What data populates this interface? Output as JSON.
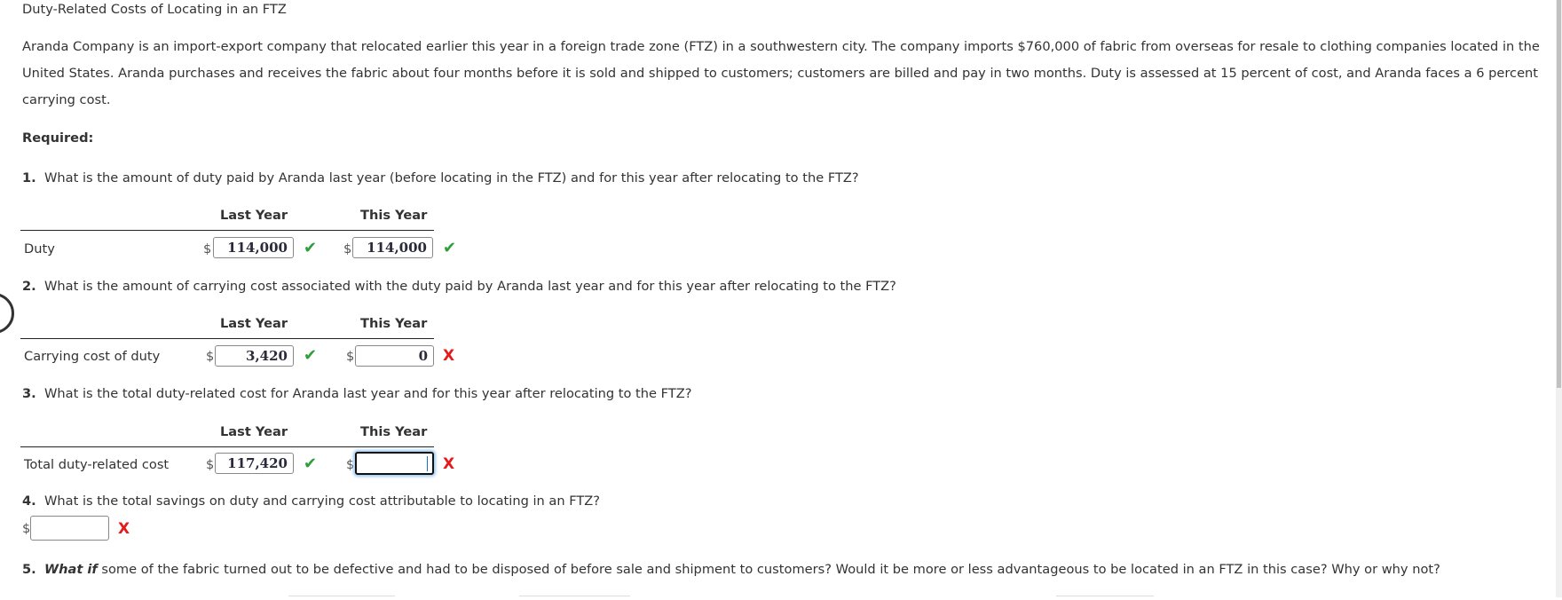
{
  "title": "Duty-Related Costs of Locating in an FTZ",
  "intro": "Aranda Company is an import-export company that relocated earlier this year in a foreign trade zone (FTZ) in a southwestern city. The company imports $760,000 of fabric from overseas for resale to clothing companies located in the United States. Aranda purchases and receives the fabric about four months before it is sold and shipped to customers; customers are billed and pay in two months. Duty is assessed at 15 percent of cost, and Aranda faces a 6 percent carrying cost.",
  "required_label": "Required:",
  "currency_symbol": "$",
  "columns": {
    "last_year": "Last Year",
    "this_year": "This Year"
  },
  "status_icons": {
    "correct": "✔",
    "incorrect": "X"
  },
  "colors": {
    "correct": "#2e9e3a",
    "incorrect": "#e31b1b",
    "focus_glow": "#9cc8f0"
  },
  "questions": [
    {
      "number": "1.",
      "text": "What is the amount of duty paid by Aranda last year (before locating in the FTZ) and for this year after relocating to the FTZ?",
      "row_label": "Duty",
      "last_year": {
        "value": "114,000",
        "status": "correct"
      },
      "this_year": {
        "value": "114,000",
        "status": "correct"
      }
    },
    {
      "number": "2.",
      "text": "What is the amount of carrying cost associated with the duty paid by Aranda last year and for this year after relocating to the FTZ?",
      "row_label": "Carrying cost of duty",
      "last_year": {
        "value": "3,420",
        "status": "correct"
      },
      "this_year": {
        "value": "0",
        "status": "incorrect"
      }
    },
    {
      "number": "3.",
      "text": "What is the total duty-related cost for Aranda last year and for this year after relocating to the FTZ?",
      "row_label": "Total duty-related cost",
      "last_year": {
        "value": "117,420",
        "status": "correct"
      },
      "this_year": {
        "value": "",
        "status": "incorrect",
        "focused": true
      }
    },
    {
      "number": "4.",
      "text": "What is the total savings on duty and carrying cost attributable to locating in an FTZ?",
      "answer": {
        "value": "",
        "status": "incorrect"
      }
    },
    {
      "number": "5.",
      "emphasis": "What if",
      "text": " some of the fabric turned out to be defective and had to be disposed of before sale and shipment to customers? Would it be more or less advantageous to be located in an FTZ in this case? Why or why not?"
    }
  ]
}
